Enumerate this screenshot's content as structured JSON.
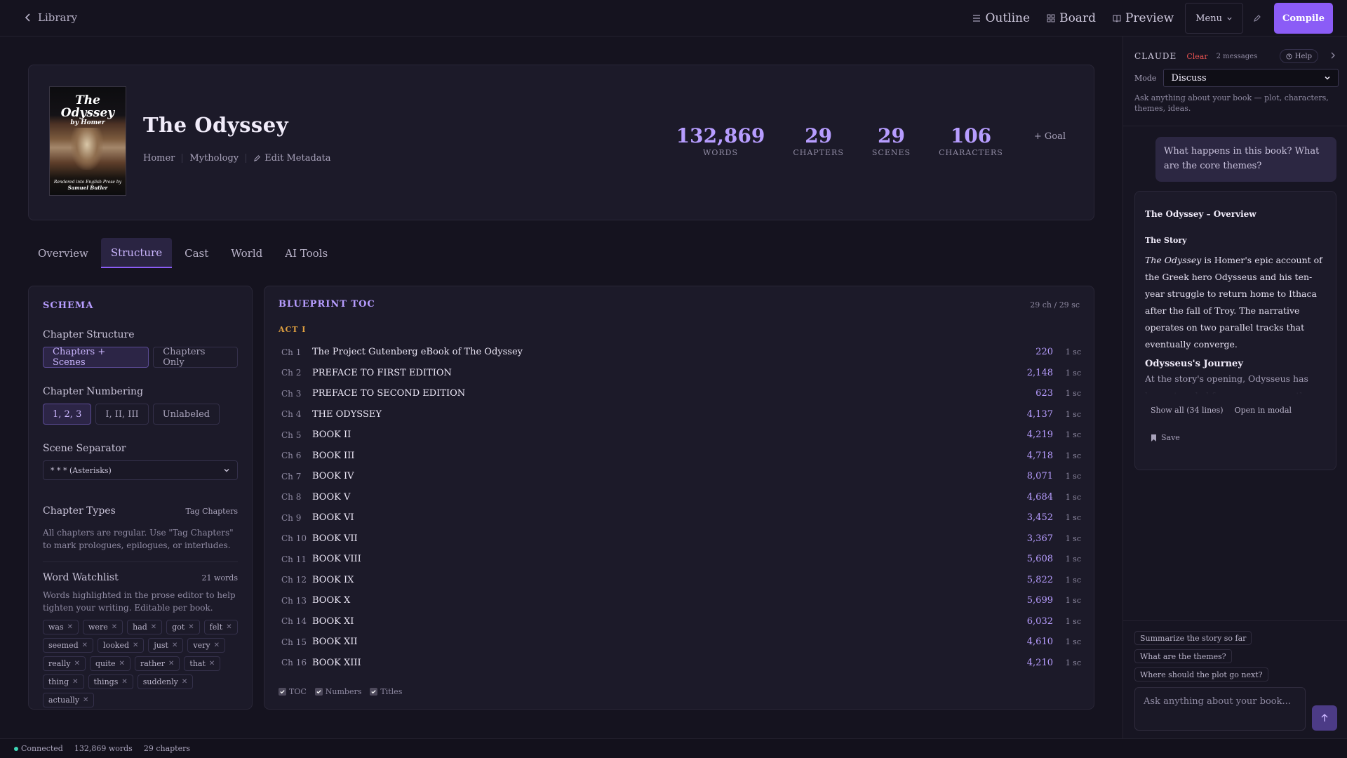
{
  "topbar": {
    "back_label": "Library",
    "nav": [
      {
        "label": "Outline",
        "icon": "list-icon"
      },
      {
        "label": "Board",
        "icon": "grid-icon"
      },
      {
        "label": "Preview",
        "icon": "book-open-icon"
      }
    ],
    "menu_label": "Menu",
    "compile_label": "Compile",
    "accent": "#8b5cf6"
  },
  "book": {
    "cover": {
      "title": "The Odyssey",
      "author": "by Homer",
      "foot_line": "Rendered into English Prose by",
      "foot_name": "Samuel Butler"
    },
    "title": "The Odyssey",
    "author": "Homer",
    "genre": "Mythology",
    "edit_label": "Edit Metadata",
    "stats": [
      {
        "value": "132,869",
        "label": "WORDS"
      },
      {
        "value": "29",
        "label": "CHAPTERS"
      },
      {
        "value": "29",
        "label": "SCENES"
      },
      {
        "value": "106",
        "label": "CHARACTERS"
      }
    ],
    "goal_label": "+ Goal"
  },
  "tabs": [
    {
      "label": "Overview",
      "active": false
    },
    {
      "label": "Structure",
      "active": true
    },
    {
      "label": "Cast",
      "active": false
    },
    {
      "label": "World",
      "active": false
    },
    {
      "label": "AI Tools",
      "active": false
    }
  ],
  "schema": {
    "heading": "SCHEMA",
    "structure_label": "Chapter Structure",
    "structure_options": [
      "Chapters + Scenes",
      "Chapters Only"
    ],
    "numbering_label": "Chapter Numbering",
    "numbering_options": [
      "1, 2, 3",
      "I, II, III",
      "Unlabeled"
    ],
    "separator_label": "Scene Separator",
    "separator_value": "* * * (Asterisks)",
    "types_label": "Chapter Types",
    "tag_link": "Tag Chapters",
    "types_hint": "All chapters are regular. Use \"Tag Chapters\" to mark prologues, epilogues, or interludes.",
    "watch_label": "Word Watchlist",
    "watch_count": "21 words",
    "watch_hint": "Words highlighted in the prose editor to help tighten your writing. Editable per book.",
    "words": [
      "was",
      "were",
      "had",
      "got",
      "felt",
      "seemed",
      "looked",
      "just",
      "very",
      "really",
      "quite",
      "rather",
      "that",
      "thing",
      "things",
      "suddenly",
      "actually"
    ]
  },
  "toc": {
    "heading": "BLUEPRINT TOC",
    "count": "29 ch / 29 sc",
    "act": "ACT I",
    "rows": [
      {
        "ch": "Ch 1",
        "title": "The Project Gutenberg eBook of The Odyssey",
        "words": "220",
        "sc": "1 sc"
      },
      {
        "ch": "Ch 2",
        "title": "PREFACE TO FIRST EDITION",
        "words": "2,148",
        "sc": "1 sc"
      },
      {
        "ch": "Ch 3",
        "title": "PREFACE TO SECOND EDITION",
        "words": "623",
        "sc": "1 sc"
      },
      {
        "ch": "Ch 4",
        "title": "THE ODYSSEY",
        "words": "4,137",
        "sc": "1 sc"
      },
      {
        "ch": "Ch 5",
        "title": "BOOK II",
        "words": "4,219",
        "sc": "1 sc"
      },
      {
        "ch": "Ch 6",
        "title": "BOOK III",
        "words": "4,718",
        "sc": "1 sc"
      },
      {
        "ch": "Ch 7",
        "title": "BOOK IV",
        "words": "8,071",
        "sc": "1 sc"
      },
      {
        "ch": "Ch 8",
        "title": "BOOK V",
        "words": "4,684",
        "sc": "1 sc"
      },
      {
        "ch": "Ch 9",
        "title": "BOOK VI",
        "words": "3,452",
        "sc": "1 sc"
      },
      {
        "ch": "Ch 10",
        "title": "BOOK VII",
        "words": "3,367",
        "sc": "1 sc"
      },
      {
        "ch": "Ch 11",
        "title": "BOOK VIII",
        "words": "5,608",
        "sc": "1 sc"
      },
      {
        "ch": "Ch 12",
        "title": "BOOK IX",
        "words": "5,822",
        "sc": "1 sc"
      },
      {
        "ch": "Ch 13",
        "title": "BOOK X",
        "words": "5,699",
        "sc": "1 sc"
      },
      {
        "ch": "Ch 14",
        "title": "BOOK XI",
        "words": "6,032",
        "sc": "1 sc"
      },
      {
        "ch": "Ch 15",
        "title": "BOOK XII",
        "words": "4,610",
        "sc": "1 sc"
      },
      {
        "ch": "Ch 16",
        "title": "BOOK XIII",
        "words": "4,210",
        "sc": "1 sc"
      }
    ],
    "options": [
      {
        "label": "TOC",
        "checked": true
      },
      {
        "label": "Numbers",
        "checked": true
      },
      {
        "label": "Titles",
        "checked": true
      }
    ]
  },
  "sidebar": {
    "title": "CLAUDE",
    "clear_label": "Clear",
    "message_count": "2 messages",
    "help_label": "Help",
    "mode_label": "Mode",
    "mode_value": "Discuss",
    "hint": "Ask anything about your book — plot, characters, themes, ideas.",
    "user_message": "What happens in this book?  What are the core themes?",
    "reply": {
      "heading": "The Odyssey – Overview",
      "section": "The Story",
      "para_em": "The Odyssey",
      "para_rest": " is Homer's epic account of the Greek hero Odysseus and his ten-year struggle to return home to Ithaca after the fall of Troy. The narrative operates on two parallel tracks that eventually converge.",
      "subheading": "Odysseus's Journey",
      "fade_text": "At the story's opening, Odysseus has been stranded for seven years on the island of",
      "show_all": "Show all (34 lines)",
      "open_modal": "Open in modal",
      "save_label": "Save"
    },
    "suggestions": [
      "Summarize the story so far",
      "What are the themes?",
      "Where should the plot go next?"
    ],
    "input_placeholder": "Ask anything about your book..."
  },
  "status": {
    "connected": "Connected",
    "words": "132,869 words",
    "chapters": "29 chapters",
    "dot_color": "#3ed6b6"
  }
}
